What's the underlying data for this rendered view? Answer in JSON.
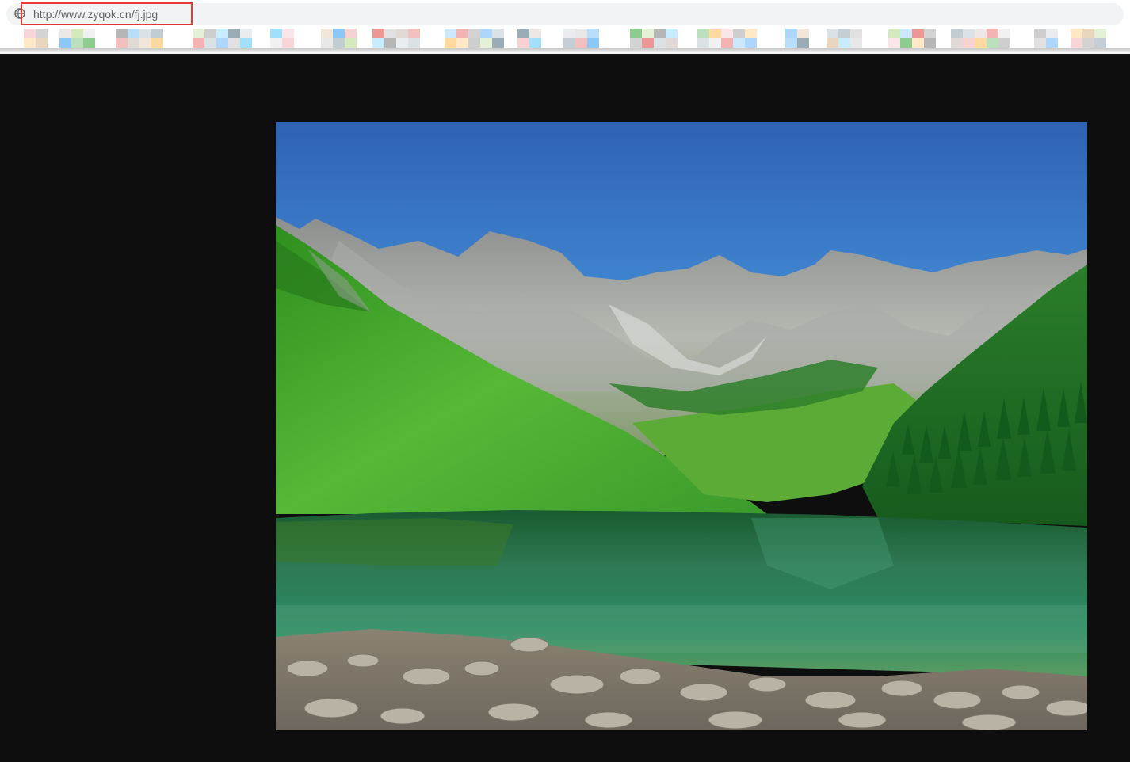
{
  "browser": {
    "url": "http://www.zyqok.cn/fj.jpg",
    "site_icon": "globe-icon"
  },
  "viewer": {
    "background_color": "#0e0e0e",
    "image": {
      "subject": "",
      "icon": "image"
    }
  },
  "annotation": {
    "highlight_color": "#e53935"
  },
  "colors": {
    "sky_top": "#2f66b8",
    "sky_bottom": "#4d93d6",
    "grass": "#3fa52a",
    "forest": "#1d6a22",
    "lake": "#1f6a4a",
    "rocks": "#9b9690"
  }
}
